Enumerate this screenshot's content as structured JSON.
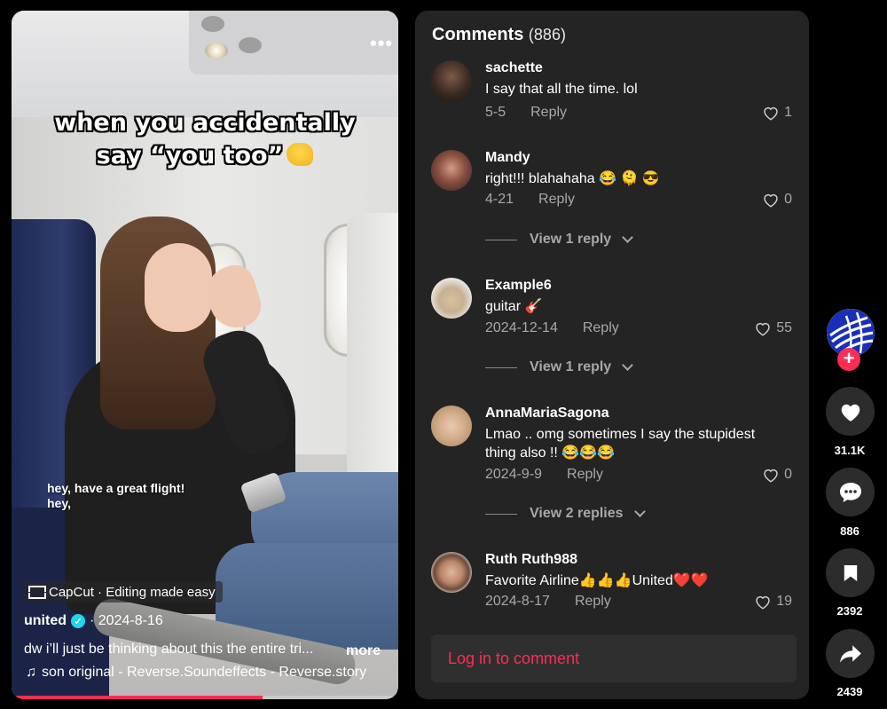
{
  "video": {
    "caption_line1": "when you accidentally",
    "caption_line2": "say “you too”",
    "subtitle_line1": "hey, have a great flight!",
    "subtitle_line2": "hey,",
    "capcut_label": "CapCut · Editing made easy",
    "author": "united",
    "date": "· 2024-8-16",
    "description": "dw i’ll just be thinking about this the entire tri...",
    "more_label": "more",
    "music": "son original - Reverse.Soundeffects - Reverse.story",
    "progress": 0.65
  },
  "comments_panel": {
    "title": "Comments",
    "count": "(886)",
    "comments": [
      {
        "user": "sachette",
        "text": "I say that all the time. lol",
        "date": "5-5",
        "reply_label": "Reply",
        "likes": "1"
      },
      {
        "user": "Mandy",
        "text": "right!!! blahahaha 😂 🫠 😎",
        "date": "4-21",
        "reply_label": "Reply",
        "likes": "0",
        "view_replies": "View 1 reply"
      },
      {
        "user": "Example6",
        "text": "guitar 🎸",
        "date": "2024-12-14",
        "reply_label": "Reply",
        "likes": "55",
        "view_replies": "View 1 reply"
      },
      {
        "user": "AnnaMariaSagona",
        "text": "Lmao .. omg sometimes I say the stupidest thing also !! 😂😂😂",
        "date": "2024-9-9",
        "reply_label": "Reply",
        "likes": "0",
        "view_replies": "View 2 replies"
      },
      {
        "user": "Ruth Ruth988",
        "text": "Favorite Airline👍👍👍United❤️❤️",
        "date": "2024-8-17",
        "reply_label": "Reply",
        "likes": "19"
      }
    ],
    "login_label": "Log in to comment"
  },
  "actions": {
    "follow_label": "+",
    "likes": "31.1K",
    "comments": "886",
    "saves": "2392",
    "shares": "2439"
  },
  "colors": {
    "accent": "#fe2c55",
    "panel_bg": "#242424",
    "muted": "#a8a8a8"
  }
}
